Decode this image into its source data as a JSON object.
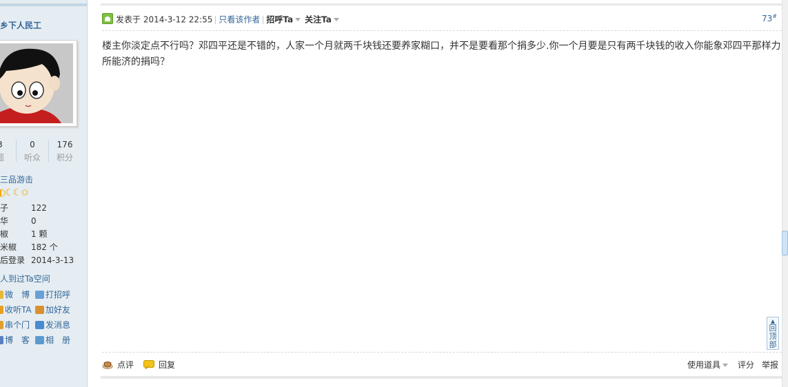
{
  "sidebar": {
    "username": "乡下人民工",
    "stats": [
      {
        "num": "3",
        "label": "题"
      },
      {
        "num": "0",
        "label": "听众"
      },
      {
        "num": "176",
        "label": "积分"
      }
    ],
    "level": "三品游击",
    "stars": "◐☾☾✩",
    "info": [
      {
        "key": "子",
        "value": "122"
      },
      {
        "key": "华",
        "value": "0"
      },
      {
        "key": "椒",
        "value": "1 颗"
      },
      {
        "key": "米椒",
        "value": "182 个"
      },
      {
        "key": "后登录",
        "value": "2014-3-13"
      }
    ],
    "visitors": "人到过Ta空间",
    "actions": [
      {
        "label": "微　博",
        "color": "#e8b83a"
      },
      {
        "label": "打招呼",
        "color": "#6aa0d8"
      },
      {
        "label": "收听TA",
        "color": "#e8a020"
      },
      {
        "label": "加好友",
        "color": "#d89030"
      },
      {
        "label": "串个门",
        "color": "#e0a030"
      },
      {
        "label": "发消息",
        "color": "#4a8ad0"
      },
      {
        "label": "博　客",
        "color": "#5a80c0"
      },
      {
        "label": "相　册",
        "color": "#5a9ad0"
      }
    ]
  },
  "post": {
    "posted_prefix": "发表于",
    "posted_time": "2014-3-12 22:55",
    "only_author": "只看该作者",
    "greet": "招呼Ta",
    "follow": "关注Ta",
    "floor": "73",
    "floor_mark": "#",
    "content": "楼主你淡定点不行吗？邓四平还是不错的，人家一个月就两千块钱还要养家糊口，并不是要看那个捐多少.你一个月要是只有两千块钱的收入你能象邓四平那样力所能济的捐吗？"
  },
  "footer": {
    "comment": "点评",
    "reply": "回复",
    "tools": "使用道具",
    "rate": "评分",
    "report": "举报"
  },
  "back_to_top": {
    "line1": "回",
    "line2": "顶",
    "line3": "部"
  }
}
